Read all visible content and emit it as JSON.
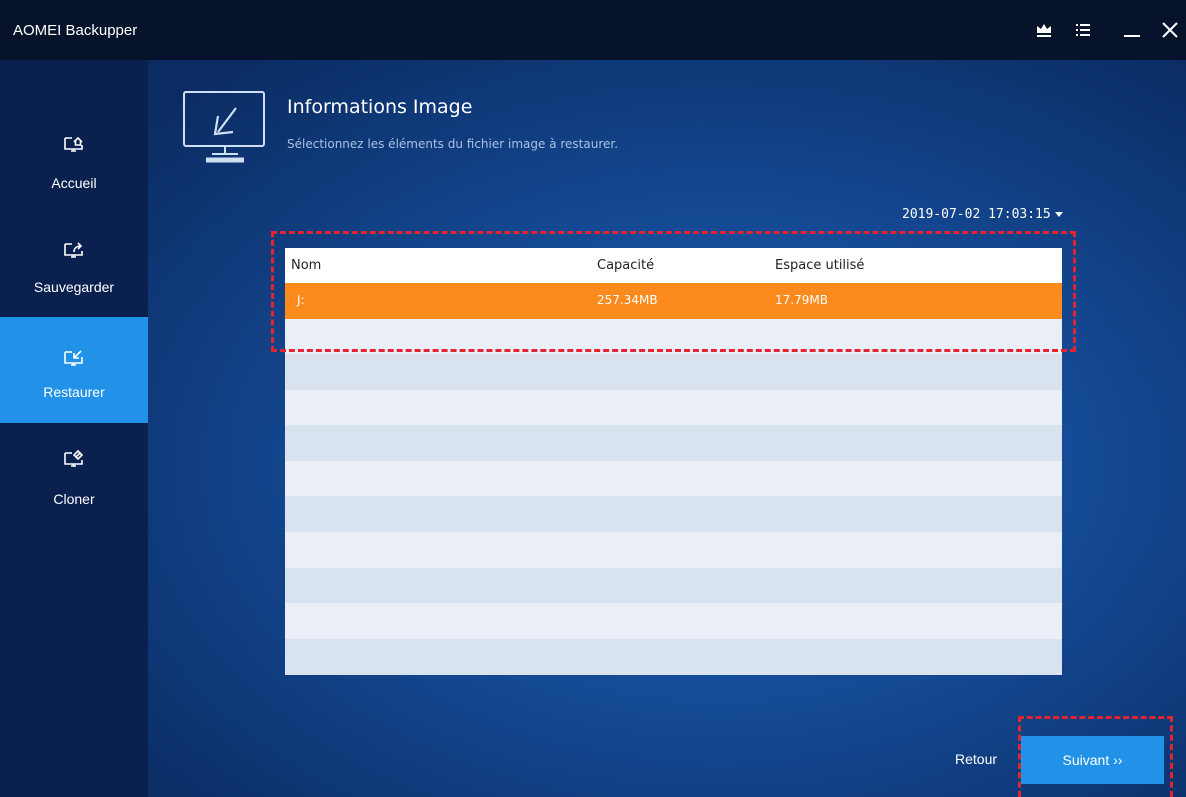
{
  "app": {
    "title": "AOMEI Backupper"
  },
  "window_controls": {
    "upgrade_icon": "crown-icon",
    "menu_icon": "menu-icon",
    "minimize_icon": "minimize-icon",
    "close_icon": "close-icon"
  },
  "sidebar": {
    "items": [
      {
        "label": "Accueil",
        "icon": "home-icon",
        "active": false
      },
      {
        "label": "Sauvegarder",
        "icon": "backup-icon",
        "active": false
      },
      {
        "label": "Restaurer",
        "icon": "restore-icon",
        "active": true
      },
      {
        "label": "Cloner",
        "icon": "clone-icon",
        "active": false
      }
    ]
  },
  "header": {
    "title": "Informations Image",
    "subtitle": "Sélectionnez les éléments du fichier image à restaurer.",
    "icon": "restore-monitor-icon"
  },
  "backup_point": {
    "selected": "2019-07-02 17:03:15"
  },
  "table": {
    "columns": [
      "Nom",
      "Capacité",
      "Espace utilisé"
    ],
    "rows": [
      {
        "name": "J:",
        "capacity": "257.34MB",
        "used": "17.79MB",
        "selected": true
      }
    ]
  },
  "footer": {
    "back_label": "Retour",
    "next_label": "Suivant ››"
  },
  "colors": {
    "accent": "#2192e8",
    "selection": "#fc8a1c",
    "highlight_dash": "#e3232f",
    "titlebar": "#07132b",
    "sidebar": "#0a2150"
  }
}
